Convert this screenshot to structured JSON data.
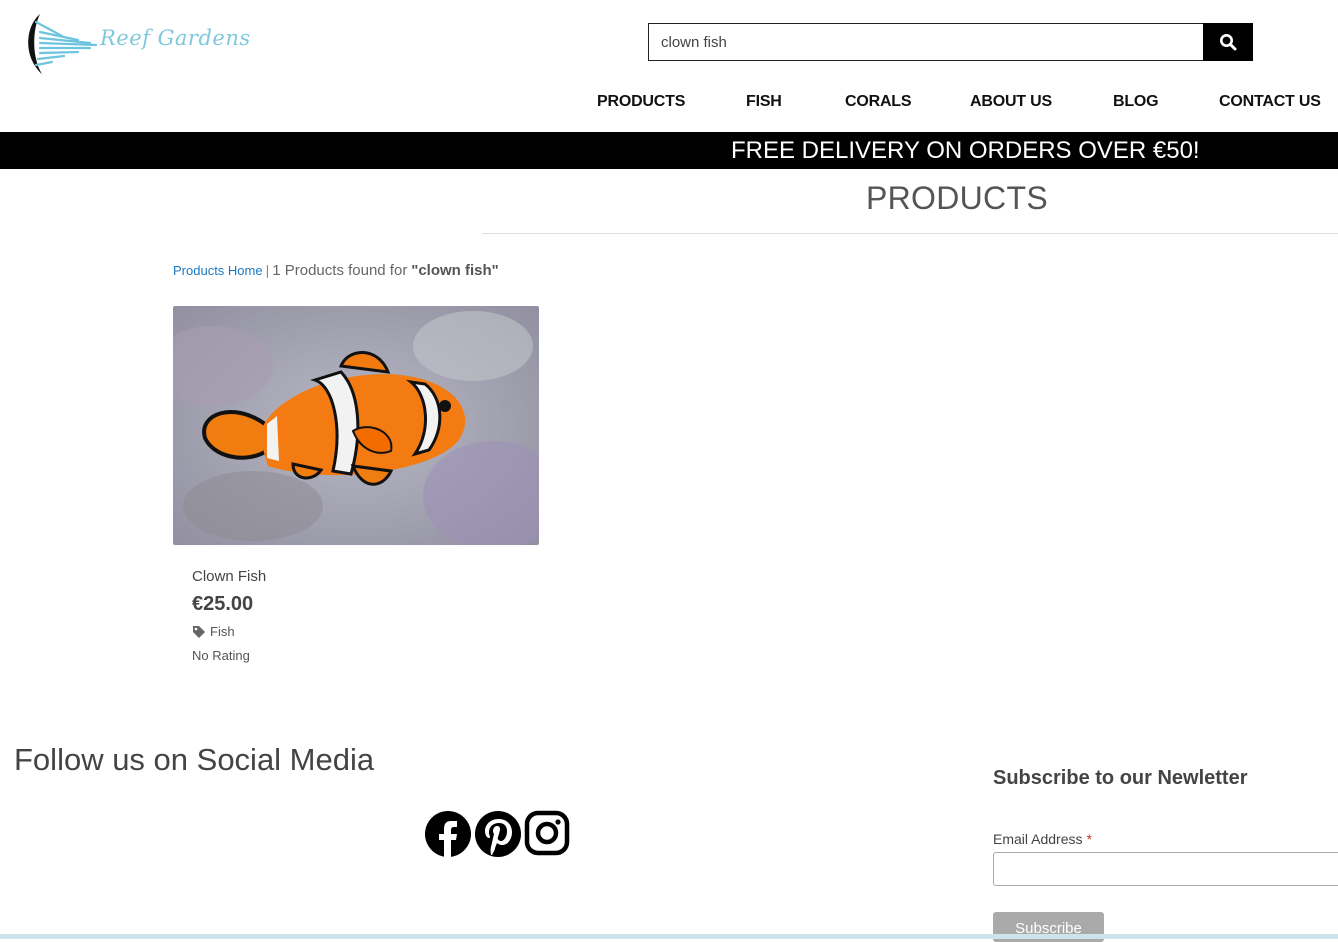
{
  "brand": {
    "name": "Reef Gardens"
  },
  "search": {
    "value": "clown fish",
    "icon": "search-icon"
  },
  "nav": {
    "items": [
      {
        "label": "PRODUCTS"
      },
      {
        "label": "FISH"
      },
      {
        "label": "CORALS"
      },
      {
        "label": "ABOUT US"
      },
      {
        "label": "BLOG"
      },
      {
        "label": "CONTACT US"
      }
    ]
  },
  "banner": {
    "text": "FREE DELIVERY ON ORDERS OVER €50!"
  },
  "page": {
    "title": "PRODUCTS"
  },
  "breadcrumb": {
    "home_link": "Products Home",
    "separator": "|",
    "count_text": "1 Products found for",
    "query": "\"clown fish\""
  },
  "products": [
    {
      "name": "Clown Fish",
      "price": "€25.00",
      "category": "Fish",
      "rating": "No Rating",
      "image": "clownfish-photo"
    }
  ],
  "social": {
    "heading": "Follow us on Social Media",
    "icons": [
      "facebook-icon",
      "pinterest-icon",
      "instagram-icon"
    ]
  },
  "newsletter": {
    "heading": "Subscribe to our Newletter",
    "email_label": "Email Address",
    "required_mark": "*",
    "email_value": "",
    "button_label": "Subscribe"
  },
  "colors": {
    "banner_bg": "#000000",
    "link": "#1b78c2",
    "logo_accent": "#7fc8de",
    "subscribe_bg": "#aaaaaa"
  }
}
